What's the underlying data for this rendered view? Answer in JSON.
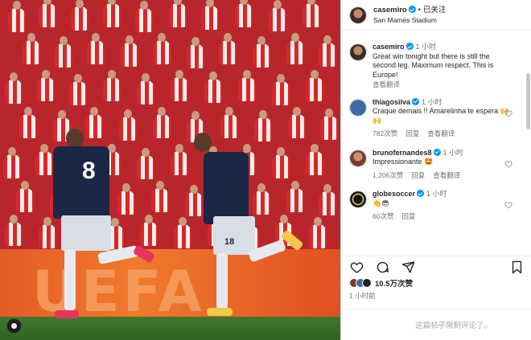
{
  "post": {
    "author": "casemiro",
    "follow_status": "已关注",
    "separator": "•",
    "location": "San Mamés Stadium",
    "caption": {
      "user": "casemiro",
      "time": "1 小时",
      "text": "Great win tonight but there is still the second leg. Maximum respect. This is Europe!",
      "translate": "查看翻译"
    },
    "photo": {
      "player1_number": "8",
      "player2_number": "18",
      "banner_text": "UEFA"
    }
  },
  "comments": [
    {
      "user": "thiagosilva",
      "time": "1 小时",
      "text": "Craque demais !! Amarelinha te espera 🙌🙌",
      "likes": "782次赞",
      "reply": "回复",
      "translate": "查看翻译",
      "avatar_color": "#3a6ea5"
    },
    {
      "user": "brunofernandes8",
      "time": "1 小时",
      "text": "Impressionante 🤩",
      "likes": "1,206次赞",
      "reply": "回复",
      "translate": "查看翻译",
      "avatar_color": "#7a3b2e"
    },
    {
      "user": "globesoccer",
      "time": "1 小时",
      "text": "👏😎",
      "likes": "60次赞",
      "reply": "回复",
      "translate": "",
      "avatar_color": "#111111"
    }
  ],
  "actions": {
    "like_icon": "heart-icon",
    "comment_icon": "comment-icon",
    "share_icon": "share-icon",
    "save_icon": "bookmark-icon"
  },
  "likes_count": "10.5万次赞",
  "posted_ago": "1 小时前",
  "comments_restricted": "这篇帖子限制评论了。",
  "colors": {
    "verified": "#0095f6",
    "kit_home": "#d8262b",
    "kit_away": "#1c2646"
  }
}
